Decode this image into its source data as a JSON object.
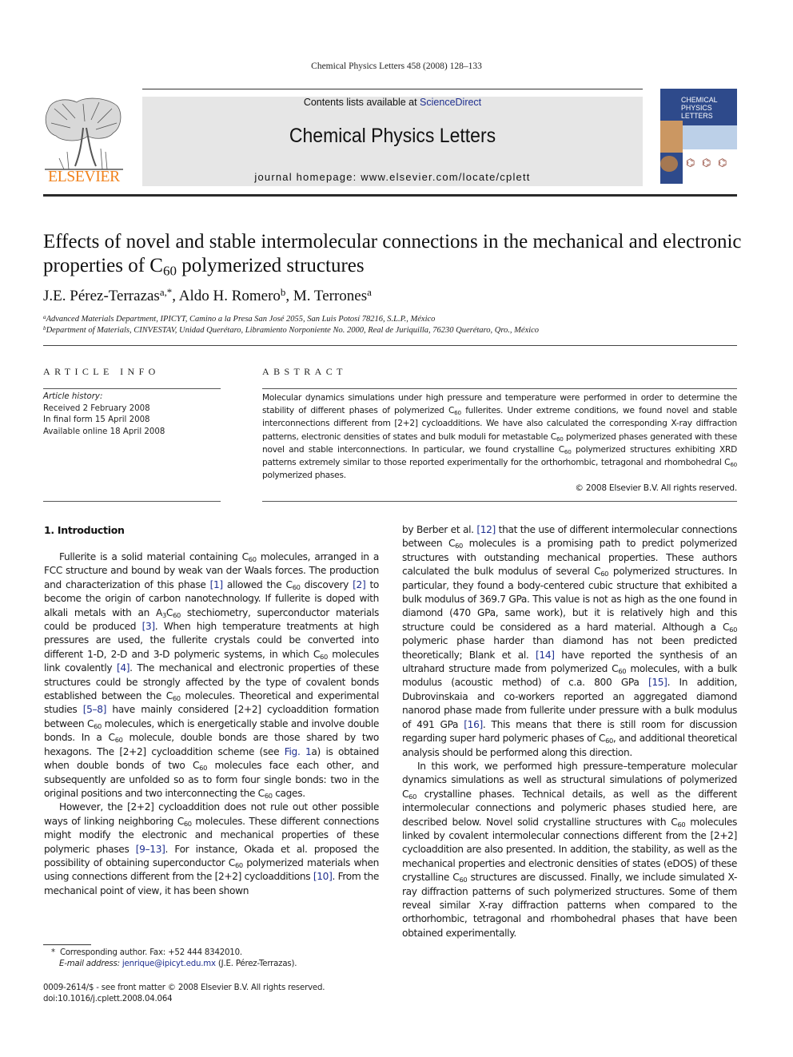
{
  "running_header": "Chemical Physics Letters 458 (2008) 128–133",
  "masthead": {
    "contents_prefix": "Contents lists available at ",
    "contents_link": "ScienceDirect",
    "journal_name": "Chemical Physics Letters",
    "homepage": "journal homepage: www.elsevier.com/locate/cplett",
    "publisher_logo_text": "ELSEVIER",
    "cover_title_lines": [
      "CHEMICAL",
      "PHYSICS",
      "LETTERS"
    ]
  },
  "article": {
    "title_part1": "Effects of novel and stable intermolecular connections in the mechanical and electronic properties of C",
    "title_sub": "60",
    "title_part2": " polymerized structures",
    "authors": [
      {
        "name": "J.E. Pérez-Terrazas",
        "sup": "a,*"
      },
      {
        "name": "Aldo H. Romero",
        "sup": "b"
      },
      {
        "name": "M. Terrones",
        "sup": "a"
      }
    ],
    "affiliations": [
      {
        "mark": "a",
        "text": "Advanced Materials Department, IPICYT, Camino a la Presa San José 2055, San Luis Potosí 78216, S.L.P., México"
      },
      {
        "mark": "b",
        "text": "Department of Materials, CINVESTAV, Unidad Querétaro, Libramiento Norponiente No. 2000, Real de Juriquilla, 76230 Querétaro, Qro., México"
      }
    ]
  },
  "article_info": {
    "heading": "ARTICLE INFO",
    "history_label": "Article history:",
    "history": [
      "Received 2 February 2008",
      "In final form 15 April 2008",
      "Available online 18 April 2008"
    ]
  },
  "abstract": {
    "heading": "ABSTRACT",
    "segments": [
      "Molecular dynamics simulations under high pressure and temperature were performed in order to determine the stability of different phases of polymerized C",
      " fullerites. Under extreme conditions, we found novel and stable interconnections different from [2+2] cycloadditions. We have also calculated the corresponding X-ray diffraction patterns, electronic densities of states and bulk moduli for metastable C",
      " polymerized phases generated with these novel and stable interconnections. In particular, we found crystalline C",
      " polymerized structures exhibiting XRD patterns extremely similar to those reported experimentally for the orthorhombic, tetragonal and rhombohedral C",
      " polymerized phases."
    ],
    "sub": "60",
    "copyright": "© 2008 Elsevier B.V. All rights reserved."
  },
  "introduction": {
    "heading": "1. Introduction",
    "sub": "60",
    "p1": [
      "Fullerite is a solid material containing C",
      "SUB",
      " molecules, arranged in a FCC structure and bound by weak van der Waals forces. The production and characterization of this phase ",
      "[1]",
      " allowed the C",
      "SUB",
      " discovery ",
      "[2]",
      " to become the origin of carbon nanotechnology. If fullerite is doped with alkali metals with an A",
      "SUB3",
      "C",
      "SUB",
      " stechiometry, superconductor materials could be produced ",
      "[3]",
      ". When high temperature treatments at high pressures are used, the fullerite crystals could be converted into different 1-D, 2-D and 3-D polymeric systems, in which C",
      "SUB",
      " molecules link covalently ",
      "[4]",
      ". The mechanical and electronic properties of these structures could be strongly affected by the type of covalent bonds established between the C",
      "SUB",
      " molecules. Theoretical and experimental studies ",
      "[5–8]",
      " have mainly considered [2+2] cycloaddition formation between C",
      "SUB",
      " molecules, which is energetically stable and involve double bonds. In a C",
      "SUB",
      " molecule, double bonds are those shared by two hexagons. The [2+2] cycloaddition scheme (see ",
      "Fig. 1",
      "a) is obtained when double bonds of two C",
      "SUB",
      " molecules face each other, and subsequently are unfolded so as to form four single bonds: two in the original positions and two interconnecting the C",
      "SUB",
      " cages."
    ],
    "p2": [
      "However, the [2+2] cycloaddition does not rule out other possible ways of linking neighboring C",
      "SUB",
      " molecules. These different connections might modify the electronic and mechanical properties of these polymeric phases ",
      "[9–13]",
      ". For instance, Okada et al. proposed the possibility of obtaining superconductor C",
      "SUB",
      " polymerized materials when using connections different from the [2+2] cycloadditions ",
      "[10]",
      ". From the mechanical point of view, it has been shown"
    ],
    "p3": [
      "by Berber et al. ",
      "[12]",
      " that the use of different intermolecular connections between C",
      "SUB",
      " molecules is a promising path to predict polymerized structures with outstanding mechanical properties. These authors calculated the bulk modulus of several C",
      "SUB",
      " polymerized structures. In particular, they found a body-centered cubic structure that exhibited a bulk modulus of 369.7 GPa. This value is not as high as the one found in diamond (470 GPa, same work), but it is relatively high and this structure could be considered as a hard material. Although a C",
      "SUB",
      " polymeric phase harder than diamond has not been predicted theoretically; Blank et al. ",
      "[14]",
      " have reported the synthesis of an ultrahard structure made from polymerized C",
      "SUB",
      " molecules, with a bulk modulus (acoustic method) of c.a. 800 GPa ",
      "[15]",
      ". In addition, Dubrovinskaia and co-workers reported an aggregated diamond nanorod phase made from fullerite under pressure with a bulk modulus of 491 GPa ",
      "[16]",
      ". This means that there is still room for discussion regarding super hard polymeric phases of C",
      "SUB",
      ", and additional theoretical analysis should be performed along this direction."
    ],
    "p4": [
      "In this work, we performed high pressure–temperature molecular dynamics simulations as well as structural simulations of polymerized C",
      "SUB",
      " crystalline phases. Technical details, as well as the different intermolecular connections and polymeric phases studied here, are described below. Novel solid crystalline structures with C",
      "SUB",
      " molecules linked by covalent intermolecular connections different from the [2+2] cycloaddition are also presented. In addition, the stability, as well as the mechanical properties and electronic densities of states (eDOS) of these crystalline C",
      "SUB",
      " structures are discussed. Finally, we include simulated X-ray diffraction patterns of such polymerized structures. Some of them reveal similar X-ray diffraction patterns when compared to the orthorhombic, tetragonal and rhombohedral phases that have been obtained experimentally."
    ]
  },
  "footnotes": {
    "corresponding_mark": "*",
    "corresponding": "Corresponding author. Fax: +52 444 8342010.",
    "email_label": "E-mail address:",
    "email": "jenrique@ipicyt.edu.mx",
    "email_suffix": " (J.E. Pérez-Terrazas).",
    "front_matter": "0009-2614/$ - see front matter © 2008 Elsevier B.V. All rights reserved.",
    "doi": "doi:10.1016/j.cplett.2008.04.064"
  },
  "colors": {
    "link": "#1f2f8f",
    "elsevier_orange": "#f08019",
    "masthead_gray": "#e6e6e6",
    "cover_blue": "#2e4a8b"
  }
}
